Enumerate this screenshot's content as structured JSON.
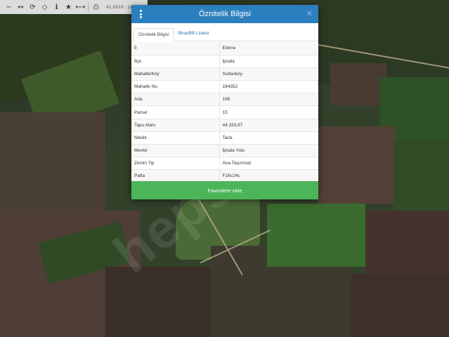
{
  "toolbar": {
    "icons": [
      "minus-icon",
      "arrows-icon",
      "refresh-icon",
      "target-icon",
      "info-icon",
      "star-icon",
      "ruler-icon",
      "print-icon"
    ],
    "coordinates": "41.0019 : 26.4072"
  },
  "dialog": {
    "title": "Öznitelik Bilgisi",
    "tabs": [
      {
        "label": "Öznitelik Bilgisi",
        "active": true
      },
      {
        "label": "Bina/BB Listesi",
        "active": false
      }
    ],
    "rows": [
      {
        "key": "İl",
        "value": "Edirne"
      },
      {
        "key": "İlçe",
        "value": "İpsala"
      },
      {
        "key": "Mahalle/Köy",
        "value": "Sultanköy"
      },
      {
        "key": "Mahalle No",
        "value": "164352"
      },
      {
        "key": "Ada",
        "value": "196"
      },
      {
        "key": "Parsel",
        "value": "15"
      },
      {
        "key": "Tapu Alanı",
        "value": "44.333,97"
      },
      {
        "key": "Nitelik",
        "value": "Tarla"
      },
      {
        "key": "Mevkii",
        "value": "İpsala Yolu"
      },
      {
        "key": "Zemin Tip",
        "value": "Ana Taşınmaz"
      },
      {
        "key": "Pafta",
        "value": "F16c24c"
      }
    ],
    "favorite_button": "Favorilere ekle"
  },
  "watermark": "hepsi",
  "colors": {
    "header": "#2c7fbf",
    "button": "#4cb55a"
  }
}
